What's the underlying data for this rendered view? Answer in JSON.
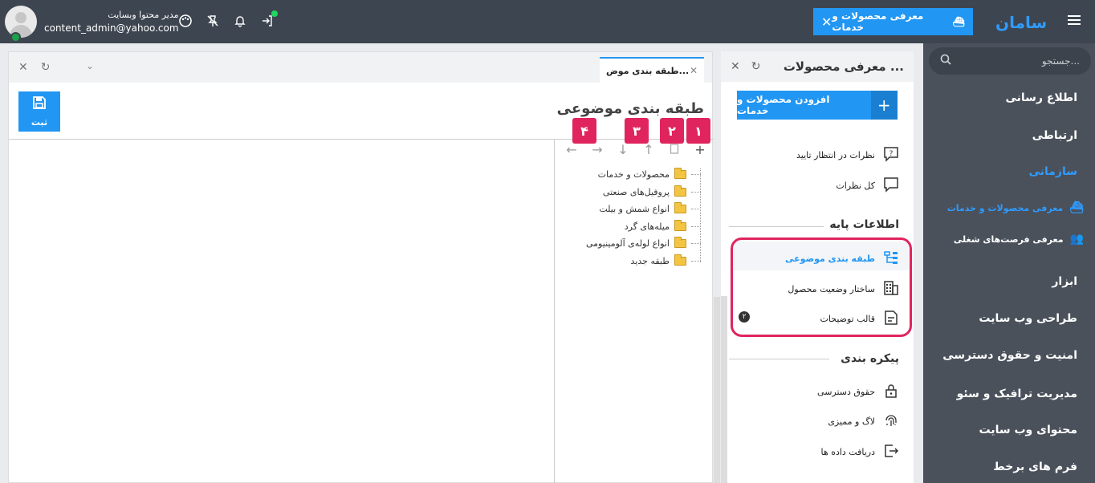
{
  "topbar": {
    "user_role": "مدیر محتوا وبسایت",
    "user_email": "content_admin@yahoo.com",
    "active_tab_label": "معرفی محصولات و خدمات",
    "brand": "سامان",
    "icons": [
      "palette-icon",
      "pin-off-icon",
      "bell-icon",
      "login-icon"
    ]
  },
  "sidebar": {
    "search_placeholder": "جستجو...",
    "items": [
      {
        "label": "اطلاع رسانی"
      },
      {
        "label": "ارتباطی"
      },
      {
        "label": "سازمانی"
      },
      {
        "label": "ابزار"
      },
      {
        "label": "طراحی وب سایت"
      },
      {
        "label": "امنیت و حقوق دسترسی"
      },
      {
        "label": "مدیریت ترافیک و سئو"
      },
      {
        "label": "محتوای وب سایت"
      },
      {
        "label": "فرم های برخط"
      }
    ],
    "subitems": [
      {
        "label": "معرفی محصولات و خدمات"
      },
      {
        "label": "معرفی فرصت‌های شغلی"
      }
    ]
  },
  "middle": {
    "title": "معرفی محصولات ...",
    "add_button": "افزودن محصولات و خدمات",
    "items": {
      "pending": "نظرات در انتظار تایید",
      "all_comments": "کل نظرات",
      "category": "طبقه بندی موضوعی",
      "product_status": "ساختار وضعیت محصول",
      "description_template": "قالب توضیحات",
      "access_rights": "حقوق دسترسی",
      "logs": "لاگ و ممیزی",
      "data_export": "دریافت داده ها"
    },
    "sections": {
      "base_info": "اطلاعات پایه",
      "config": "پیکره بندی"
    },
    "badge": "۲"
  },
  "left": {
    "tab_label": "طبقه بندی موض...",
    "page_title": "طبقه بندی موضوعی",
    "save_label": "ثبت",
    "numbers": [
      "۱",
      "۲",
      "۳",
      "۴"
    ],
    "tree": [
      "محصولات و خدمات",
      "پروفیل‌های صنعتی",
      "انواع شمش و بیلت",
      "میله‌های گرد",
      "انواع لوله‌ی آلومینیومی",
      "طبقه جدید"
    ]
  }
}
